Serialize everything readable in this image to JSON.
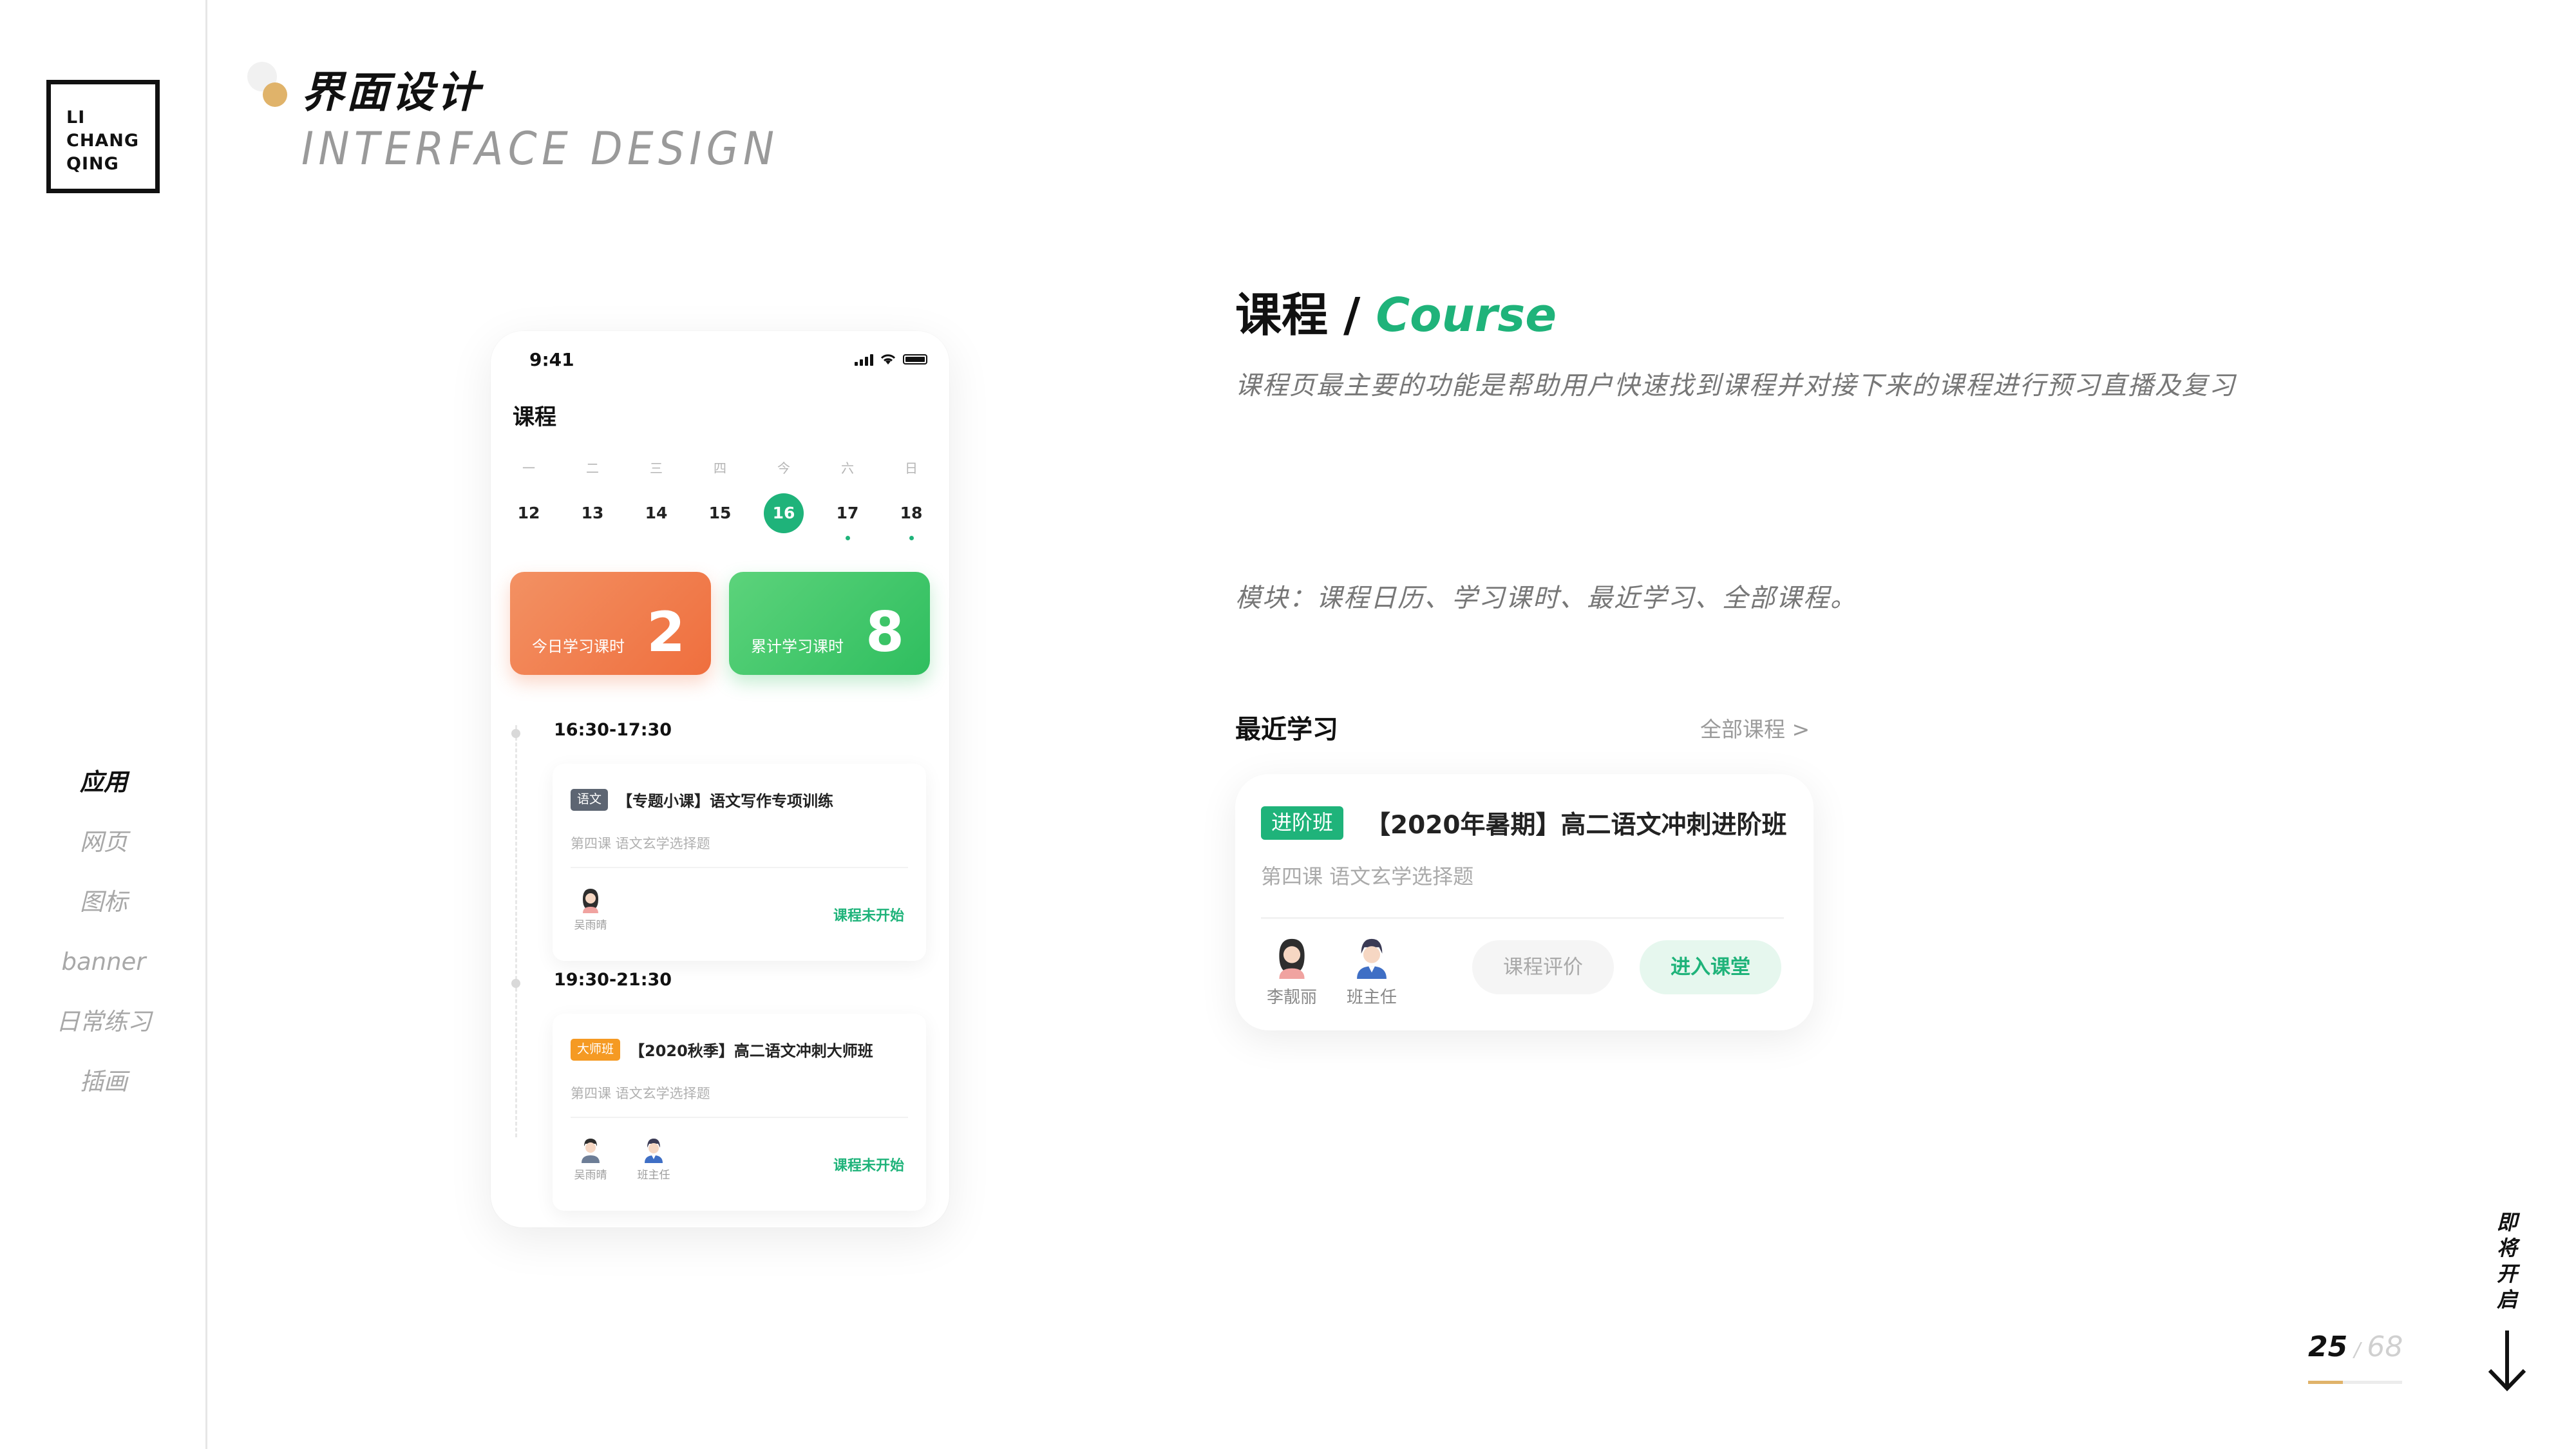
{
  "logo": {
    "lines": [
      "LI",
      "CHANG",
      "QING"
    ]
  },
  "nav": {
    "items": [
      {
        "label": "应用",
        "active": true
      },
      {
        "label": "网页",
        "active": false
      },
      {
        "label": "图标",
        "active": false
      },
      {
        "label": "banner",
        "active": false
      },
      {
        "label": "日常练习",
        "active": false
      },
      {
        "label": "插画",
        "active": false
      }
    ]
  },
  "header": {
    "title": "界面设计",
    "subtitle": "INTERFACE DESIGN"
  },
  "phone": {
    "status_time": "9:41",
    "title": "课程",
    "week": [
      {
        "weekday": "一",
        "date": "12",
        "marker": false,
        "today": false
      },
      {
        "weekday": "二",
        "date": "13",
        "marker": false,
        "today": false
      },
      {
        "weekday": "三",
        "date": "14",
        "marker": false,
        "today": false
      },
      {
        "weekday": "四",
        "date": "15",
        "marker": false,
        "today": false
      },
      {
        "weekday": "今",
        "date": "16",
        "marker": false,
        "today": true
      },
      {
        "weekday": "六",
        "date": "17",
        "marker": true,
        "today": false
      },
      {
        "weekday": "日",
        "date": "18",
        "marker": true,
        "today": false
      }
    ],
    "stats": [
      {
        "label": "今日学习课时",
        "value": "2"
      },
      {
        "label": "累计学习课时",
        "value": "8"
      }
    ],
    "slots": [
      {
        "time": "16:30-17:30",
        "tag": "语文",
        "name": "【专题小课】语文写作专项训练",
        "sub": "第四课  语文玄学选择题",
        "people": [
          "吴雨晴"
        ],
        "status": "课程未开始"
      },
      {
        "time": "19:30-21:30",
        "tag": "大师班",
        "name": "【2020秋季】高二语文冲刺大师班",
        "sub": "第四课  语文玄学选择题",
        "people": [
          "吴雨晴",
          "班主任"
        ],
        "status": "课程未开始"
      }
    ]
  },
  "course": {
    "title_cn": "课程",
    "slash": "/",
    "title_en": "Course",
    "description": "课程页最主要的功能是帮助用户快速找到课程并对接下来的课程进行预习直播及复习",
    "modules": "模块：课程日历、学习课时、最近学习、全部课程。"
  },
  "recent": {
    "heading": "最近学习",
    "all_link": "全部课程  >",
    "card": {
      "tag": "进阶班",
      "name": "【2020年暑期】高二语文冲刺进阶班",
      "sub": "第四课  语文玄学选择题",
      "people": [
        "李靓丽",
        "班主任"
      ],
      "btn_review": "课程评价",
      "btn_enter": "进入课堂"
    }
  },
  "pager": {
    "current": "25",
    "sep": "/",
    "total": "68",
    "progress": 0.37
  },
  "next": {
    "label": [
      "即",
      "将",
      "开",
      "启"
    ]
  },
  "colors": {
    "accent_green": "#1fb37a",
    "accent_orange": "#ef6f3e",
    "gold": "#e0b36a"
  }
}
